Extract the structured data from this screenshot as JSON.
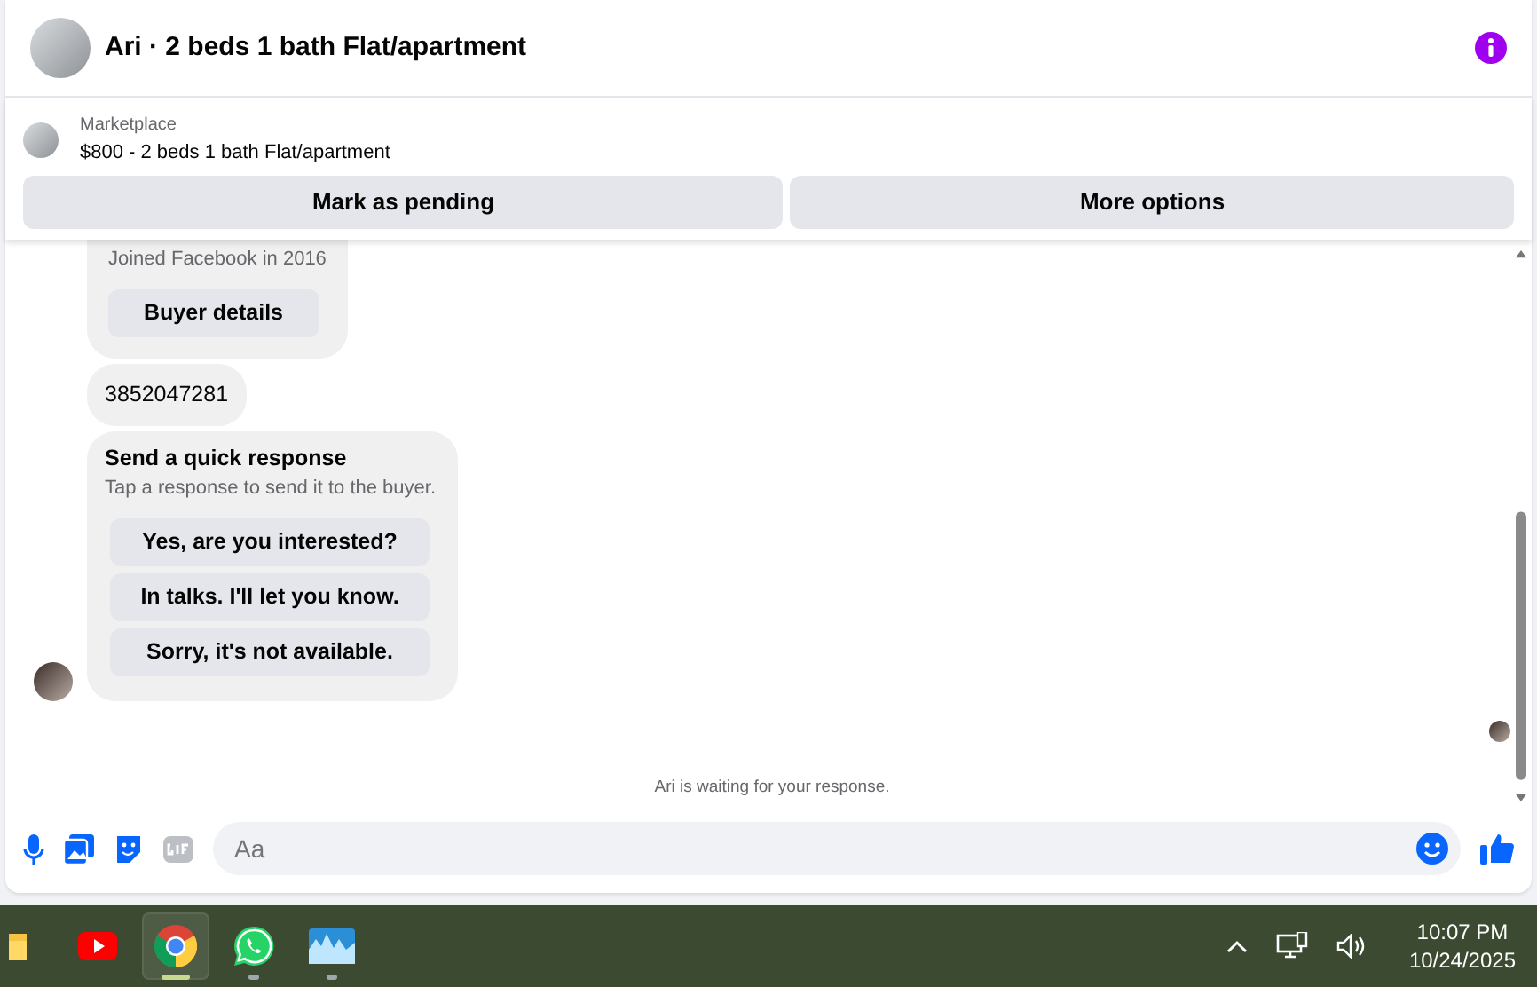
{
  "header": {
    "title": "Ari · 2 beds 1 bath Flat/apartment"
  },
  "listing": {
    "source": "Marketplace",
    "title": "$800 - 2 beds 1 bath Flat/apartment",
    "actions": [
      "Mark as pending",
      "More options"
    ]
  },
  "messages": [
    {
      "kind": "profile",
      "subtitle": "Joined Facebook in 2016",
      "button": "Buyer details"
    },
    {
      "kind": "text",
      "text": "3852047281"
    },
    {
      "kind": "quick",
      "title": "Send a quick response",
      "subtitle": "Tap a response to send it to the buyer.",
      "options": [
        "Yes, are you interested?",
        "In talks. I'll let you know.",
        "Sorry, it's not available."
      ]
    }
  ],
  "status": "Ari is waiting for your response.",
  "composer": {
    "placeholder": "Aa"
  },
  "taskbar": {
    "apps": [
      {
        "kind": "folder",
        "selected": false,
        "running": false
      },
      {
        "kind": "youtube",
        "selected": false,
        "running": false
      },
      {
        "kind": "chrome",
        "selected": true,
        "running": true
      },
      {
        "kind": "whatsapp",
        "selected": false,
        "running": true
      },
      {
        "kind": "photos",
        "selected": false,
        "running": true
      }
    ],
    "time": "10:07 PM",
    "date": "10/24/2025"
  }
}
